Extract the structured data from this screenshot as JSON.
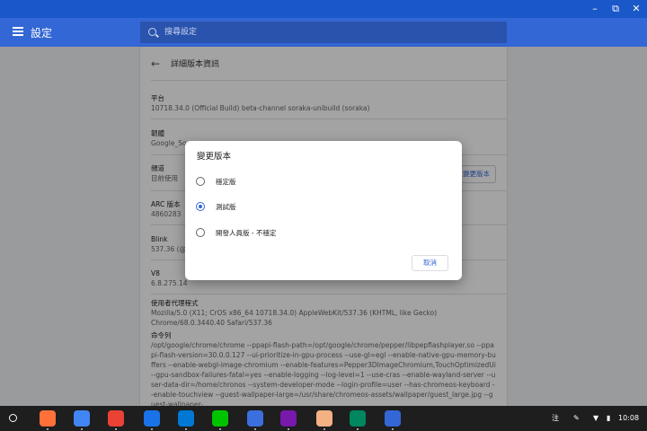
{
  "window": {
    "minimize_icon": "minimize-icon",
    "maximize_icon": "maximize-icon",
    "close_icon": "close-icon"
  },
  "header": {
    "title": "設定",
    "search_placeholder": "搜尋設定"
  },
  "page": {
    "title": "詳細版本資訊",
    "platform_label": "平台",
    "platform_value": "10718.34.0 (Official Build) beta-channel soraka-unibuild (soraka)",
    "firmware_label": "韌體",
    "firmware_value": "Google_So",
    "channel_label": "頻道",
    "channel_value": "目前使用",
    "change_channel_button": "變更版本",
    "arc_label": "ARC 版本",
    "arc_value": "4860283",
    "blink_label": "Blink",
    "blink_value": "537.36 (@",
    "v8_label": "V8",
    "v8_value": "6.8.275.14",
    "ua_label": "使用者代理程式",
    "ua_value": "Mozilla/5.0 (X11; CrOS x86_64 10718.34.0) AppleWebKit/537.36 (KHTML, like Gecko) Chrome/68.0.3440.40 Safari/537.36",
    "cmd_label": "命令列",
    "cmd_value": "/opt/google/chrome/chrome --ppapi-flash-path=/opt/google/chrome/pepper/libpepflashplayer.so --ppapi-flash-version=30.0.0.127 --ui-prioritize-in-gpu-process --use-gl=egl --enable-native-gpu-memory-buffers --enable-webgl-image-chromium --enable-features=Pepper3DImageChromium,TouchOptimizedUi --gpu-sandbox-failures-fatal=yes --enable-logging --log-level=1 --use-cras --enable-wayland-server --user-data-dir=/home/chronos --system-developer-mode --login-profile=user --has-chromeos-keyboard --enable-touchview --guest-wallpaper-large=/usr/share/chromeos-assets/wallpaper/guest_large.jpg --guest-wallpaper-"
  },
  "dialog": {
    "title": "變更版本",
    "options": [
      {
        "label": "穩定版",
        "checked": false
      },
      {
        "label": "測試版",
        "checked": true
      },
      {
        "label": "開發人員版 - 不穩定",
        "checked": false
      }
    ],
    "cancel_label": "取消"
  },
  "shelf": {
    "apps": [
      {
        "name": "firefox-icon",
        "color": "#ff7139"
      },
      {
        "name": "chrome-icon",
        "color": "#4285f4"
      },
      {
        "name": "gmail-icon",
        "color": "#ea4335"
      },
      {
        "name": "files-icon",
        "color": "#1a73e8"
      },
      {
        "name": "outlook-icon",
        "color": "#0078d4"
      },
      {
        "name": "line-icon",
        "color": "#00c300"
      },
      {
        "name": "messages-icon",
        "color": "#3b6fdd"
      },
      {
        "name": "onenote-icon",
        "color": "#7719aa"
      },
      {
        "name": "sketch-icon",
        "color": "#f4b183"
      },
      {
        "name": "play-store-icon",
        "color": "#01875f"
      },
      {
        "name": "settings-icon",
        "color": "#3367d6"
      }
    ],
    "ime": "注",
    "time": "10:08"
  },
  "colors": {
    "frame": "#1a57c9",
    "header": "#3367d6",
    "accent": "#3367d6"
  }
}
